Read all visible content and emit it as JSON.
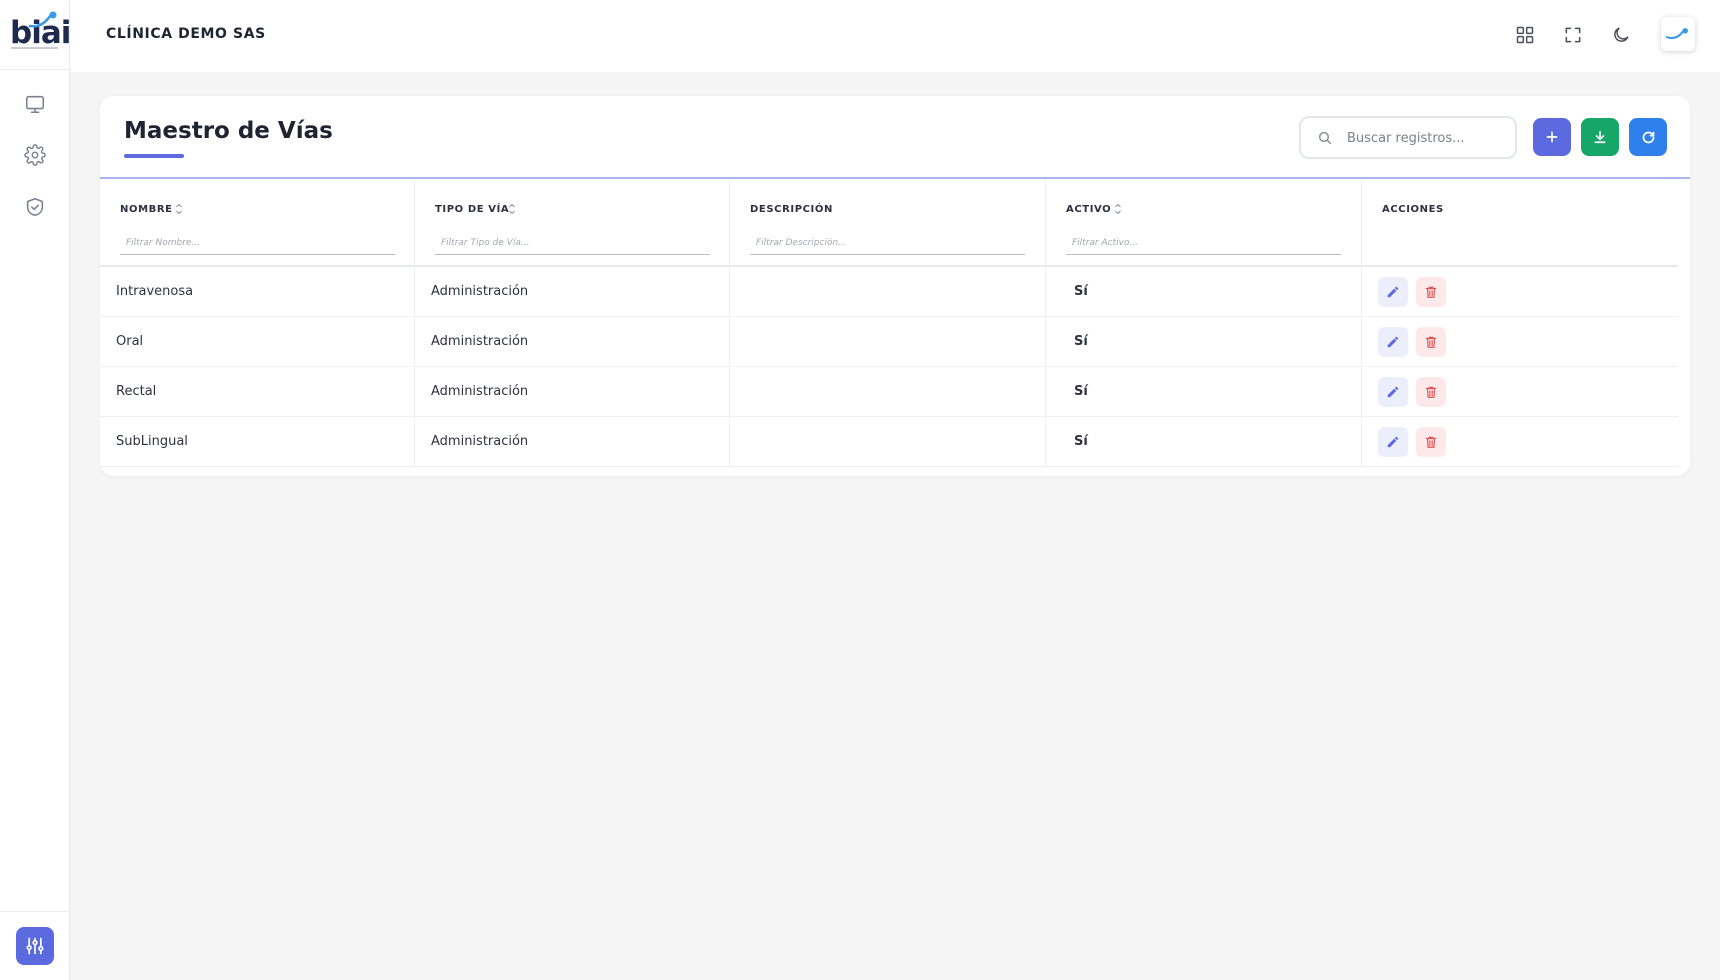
{
  "brand": {
    "logo_text": "biai",
    "company": "CLÍNICA DEMO SAS"
  },
  "sidebar": {
    "items": [
      {
        "icon": "monitor-icon"
      },
      {
        "icon": "gear-icon"
      },
      {
        "icon": "shield-check-icon"
      }
    ],
    "bottom_button_icon": "sliders-icon"
  },
  "topbar": {
    "icons": [
      "grid-icon",
      "fullscreen-icon",
      "moon-icon",
      "user-avatar"
    ]
  },
  "page": {
    "title": "Maestro de Vías",
    "search_placeholder": "Buscar registros..."
  },
  "actions": {
    "add_icon": "plus-icon",
    "download_icon": "download-icon",
    "refresh_icon": "refresh-icon"
  },
  "table": {
    "columns": [
      {
        "label": "NOMBRE",
        "filter_placeholder": "Filtrar Nombre...",
        "sortable": true
      },
      {
        "label": "TIPO DE VÍA",
        "filter_placeholder": "Filtrar Tipo de Vía...",
        "sortable": true
      },
      {
        "label": "DESCRIPCIÓN",
        "filter_placeholder": "Filtrar Descripción...",
        "sortable": false
      },
      {
        "label": "ACTIVO",
        "filter_placeholder": "Filtrar Activo...",
        "sortable": true
      },
      {
        "label": "ACCIONES",
        "filter_placeholder": "",
        "sortable": false
      }
    ],
    "rows": [
      {
        "nombre": "Intravenosa",
        "tipo": "Administración",
        "descripcion": "",
        "activo": "Sí"
      },
      {
        "nombre": "Oral",
        "tipo": "Administración",
        "descripcion": "",
        "activo": "Sí"
      },
      {
        "nombre": "Rectal",
        "tipo": "Administración",
        "descripcion": "",
        "activo": "Sí"
      },
      {
        "nombre": "SubLingual",
        "tipo": "Administración",
        "descripcion": "",
        "activo": "Sí"
      }
    ]
  },
  "colors": {
    "primary": "#5c6ae0",
    "success": "#16a667",
    "info": "#2f80ed",
    "danger": "#e05252"
  }
}
